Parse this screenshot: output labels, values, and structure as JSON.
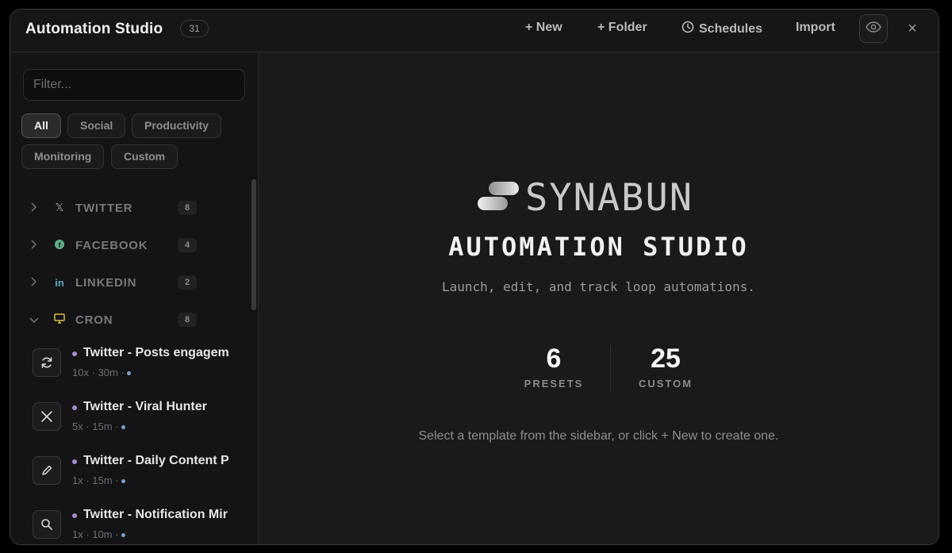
{
  "header": {
    "title": "Automation Studio",
    "count": "31",
    "new_label": "+ New",
    "folder_label": "+ Folder",
    "schedules_label": "Schedules",
    "import_label": "Import",
    "close_glyph": "×"
  },
  "sidebar": {
    "filter_placeholder": "Filter...",
    "chips": [
      "All",
      "Social",
      "Productivity",
      "Monitoring",
      "Custom"
    ],
    "active_chip": "All",
    "groups": [
      {
        "label": "TWITTER",
        "count": "8",
        "icon": "x-logo-icon",
        "glyph": "𝕏",
        "color": "#8f8f95",
        "expanded": false
      },
      {
        "label": "FACEBOOK",
        "count": "4",
        "icon": "facebook-icon",
        "glyph": "f",
        "color": "#5fae86",
        "expanded": false
      },
      {
        "label": "LINKEDIN",
        "count": "2",
        "icon": "linkedin-icon",
        "glyph": "in",
        "color": "#5fa6b8",
        "expanded": false
      },
      {
        "label": "CRON",
        "count": "8",
        "icon": "monitor-icon",
        "glyph": "▭",
        "color": "#d7b64a",
        "expanded": true
      }
    ],
    "items": [
      {
        "name": "Twitter - Posts engagem",
        "meta": "10x · 30m ·",
        "icon": "refresh-icon"
      },
      {
        "name": "Twitter - Viral Hunter",
        "meta": "5x · 15m ·",
        "icon": "x-logo-icon"
      },
      {
        "name": "Twitter - Daily Content P",
        "meta": "1x · 15m ·",
        "icon": "pencil-icon"
      },
      {
        "name": "Twitter - Notification Mir",
        "meta": "1x · 10m ·",
        "icon": "search-icon"
      }
    ]
  },
  "main": {
    "brand": "SYNABUN",
    "title": "AUTOMATION STUDIO",
    "tagline": "Launch, edit, and track loop automations.",
    "stats": [
      {
        "value": "6",
        "label": "PRESETS"
      },
      {
        "value": "25",
        "label": "CUSTOM"
      }
    ],
    "hint": "Select a template from the sidebar, or click + New to create one."
  },
  "colors": {
    "background": "#141416",
    "accent_dot": "#a98bd0",
    "status_dot": "#7aa0c8"
  }
}
